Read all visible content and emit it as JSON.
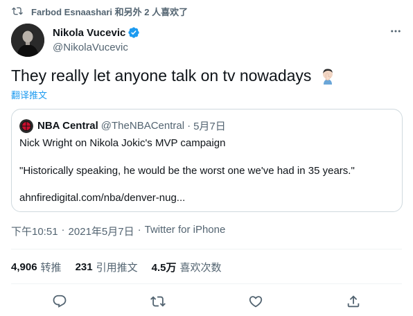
{
  "social_context": {
    "icon": "retweet-icon",
    "text": "Farbod Esnaashari 和另外 2 人喜欢了"
  },
  "author": {
    "display_name": "Nikola Vucevic",
    "handle": "@NikolaVucevic",
    "verified": true,
    "verified_color": "#1d9bf0"
  },
  "tweet": {
    "text": "They really let anyone talk on tv nowadays",
    "emoji": "face-palm-emoji",
    "translate_label": "翻译推文"
  },
  "quoted_tweet": {
    "display_name": "NBA Central",
    "handle": "@TheNBACentral",
    "separator": "·",
    "date": "5月7日",
    "line1": "Nick Wright on Nikola Jokic's MVP campaign",
    "line2": "\"Historically speaking, he would be the worst one we've had in 35 years.\"",
    "line3": "ahnfiredigital.com/nba/denver-nug..."
  },
  "meta": {
    "time": "下午10:51",
    "sep1": "·",
    "date": "2021年5月7日",
    "sep2": "·",
    "source": "Twitter for iPhone"
  },
  "stats": {
    "retweets_count": "4,906",
    "retweets_label": "转推",
    "quotes_count": "231",
    "quotes_label": "引用推文",
    "likes_count": "4.5万",
    "likes_label": "喜欢次数"
  },
  "actions": [
    "reply-icon",
    "retweet-icon",
    "like-icon",
    "share-icon"
  ],
  "colors": {
    "text_primary": "#0f1419",
    "text_secondary": "#536471",
    "accent": "#1d9bf0",
    "border": "#cfd9de",
    "divider": "#eff3f4"
  }
}
